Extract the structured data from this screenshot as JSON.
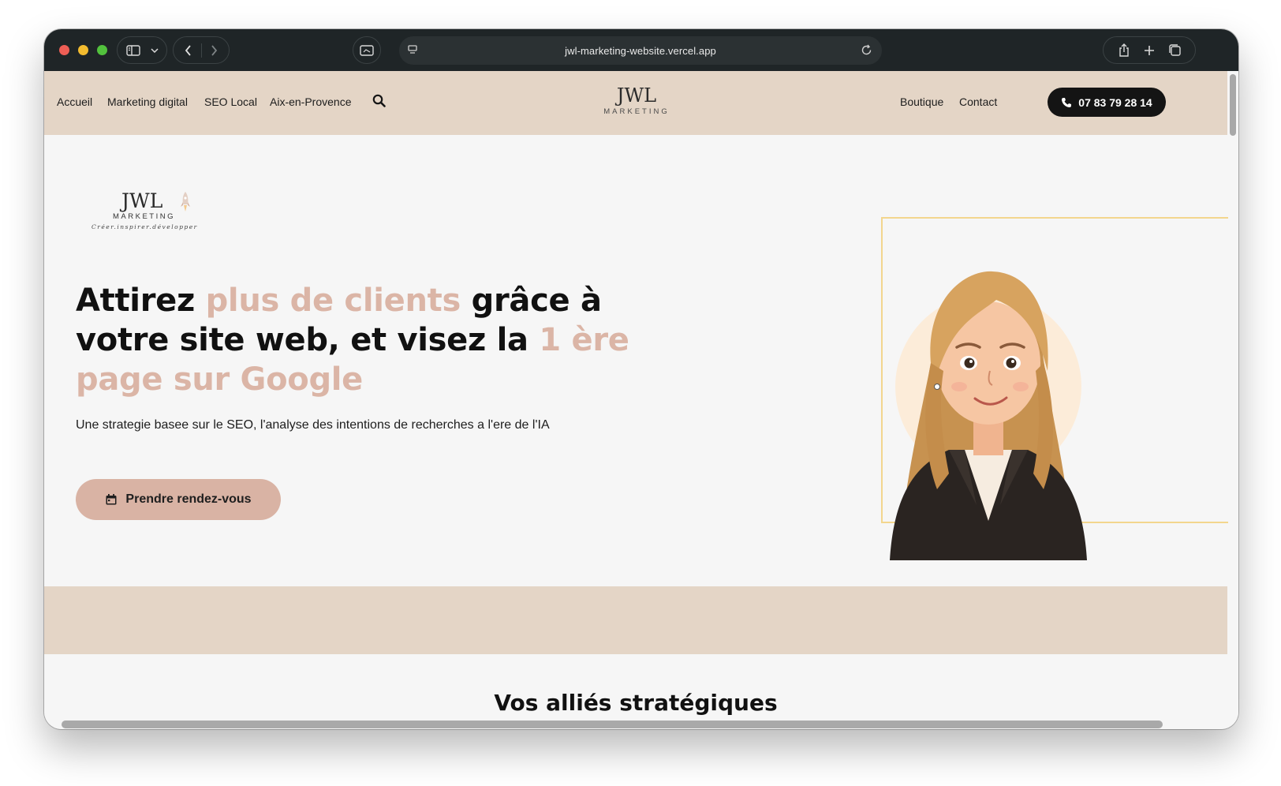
{
  "browser": {
    "url": "jwl-marketing-website.vercel.app"
  },
  "nav": {
    "left_links": [
      "Accueil",
      "Marketing digital",
      "SEO Local",
      "Aix-en-Provence"
    ],
    "right_links": [
      "Boutique",
      "Contact"
    ],
    "phone": "07 83 79 28 14",
    "logo_main": "JWL",
    "logo_sub": "MARKETING"
  },
  "hero": {
    "logo_main": "JWL",
    "logo_sub": "MARKETING",
    "logo_tagline": "Créer.inspirer.développer",
    "headline_parts": [
      {
        "text": "Attirez ",
        "accent": false
      },
      {
        "text": "plus de clients",
        "accent": true
      },
      {
        "text": " grâce à votre site web, et visez la ",
        "accent": false
      },
      {
        "text": "1 ère page sur Google",
        "accent": true
      }
    ],
    "subtext": "Une strategie basee sur le SEO, l'analyse des intentions de recherches a l'ere de l'IA",
    "cta_label": "Prendre rendez-vous"
  },
  "section": {
    "title": "Vos alliés stratégiques"
  },
  "colors": {
    "accent": "#dbb5a6",
    "beige": "#e4d5c6",
    "frame": "#f3d68e"
  }
}
